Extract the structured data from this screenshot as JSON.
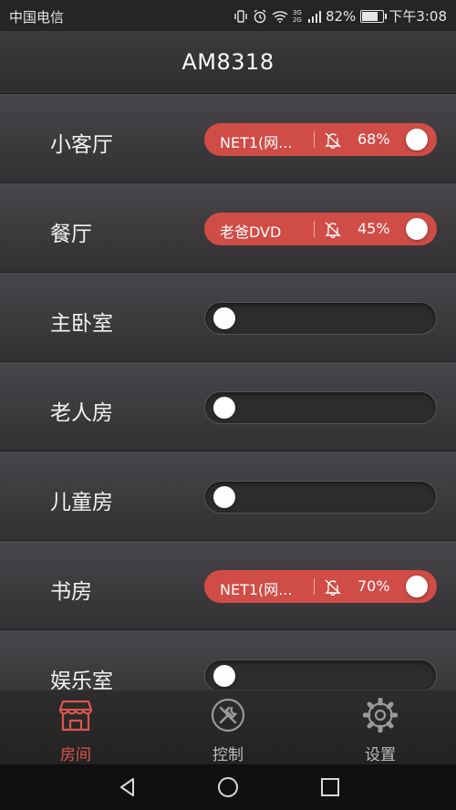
{
  "status_bar": {
    "carrier": "中国电信",
    "network_badge": "3G 2G",
    "battery": "82%",
    "battery_level": 0.82,
    "time": "下午3:08",
    "icons": [
      "vibrate-icon",
      "alarm-icon",
      "wifi-icon",
      "signal-icon",
      "battery-icon"
    ]
  },
  "header": {
    "title": "AM8318"
  },
  "rooms": [
    {
      "name": "小客厅",
      "on": true,
      "source": "NET1(网...",
      "volume": "68%"
    },
    {
      "name": "餐厅",
      "on": true,
      "source": "老爸DVD",
      "volume": "45%"
    },
    {
      "name": "主卧室",
      "on": false
    },
    {
      "name": "老人房",
      "on": false
    },
    {
      "name": "儿童房",
      "on": false
    },
    {
      "name": "书房",
      "on": true,
      "source": "NET1(网...",
      "volume": "70%"
    },
    {
      "name": "娱乐室",
      "on": false
    }
  ],
  "tabs": [
    {
      "label": "房间",
      "icon": "room-store-icon",
      "active": true
    },
    {
      "label": "控制",
      "icon": "tools-icon",
      "active": false
    },
    {
      "label": "设置",
      "icon": "gear-icon",
      "active": false
    }
  ],
  "colors": {
    "accent": "#d04c46",
    "active_tab": "#d9574f",
    "background": "#2a2828"
  },
  "nav": [
    "back-icon",
    "home-icon",
    "recents-icon"
  ]
}
